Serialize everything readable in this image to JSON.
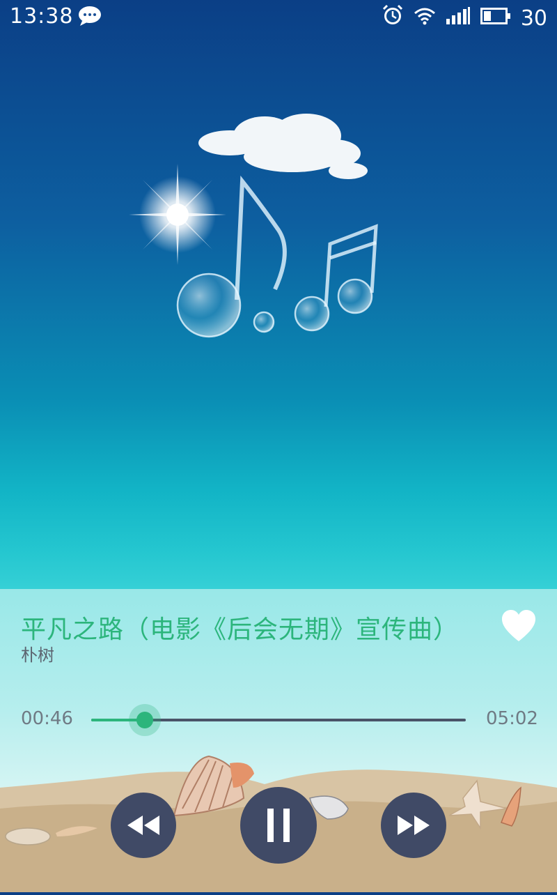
{
  "status_bar": {
    "time": "13:38",
    "battery_level": "30",
    "icons": [
      "message-icon",
      "alarm-icon",
      "wifi-icon",
      "signal-icon",
      "battery-icon"
    ]
  },
  "artwork": {
    "subject": "cloud, sun and water-drop music notes on blue sky"
  },
  "track": {
    "title": "平凡之路（电影《后会无期》宣传曲）",
    "artist": "朴树",
    "favorited": true
  },
  "progress": {
    "current_time": "00:46",
    "total_time": "05:02",
    "fraction": 0.143
  },
  "controls": {
    "previous": "rewind-icon",
    "play_pause": "pause-icon",
    "next": "fast-forward-icon"
  },
  "colors": {
    "accent": "#2cb57c",
    "control_bg": "#404a66",
    "track": "#4a5368"
  }
}
